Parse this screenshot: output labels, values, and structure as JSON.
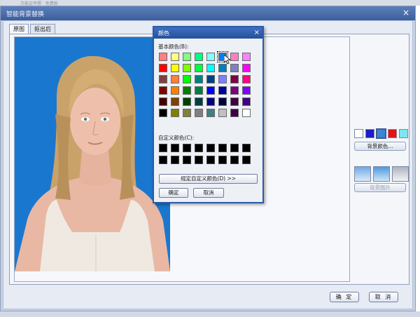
{
  "background_window": {
    "title": "_万能证件照 · 免费版"
  },
  "window": {
    "title": "智能背景替换",
    "close_glyph": "×"
  },
  "tabs": [
    {
      "label": "原图",
      "active": true
    },
    {
      "label": "抠出后",
      "active": false
    }
  ],
  "options": {
    "bg_color_swatches": [
      "#ffffff",
      "#1c1cc8",
      "#3a86d4",
      "#e41414",
      "#7de6f0"
    ],
    "selected_swatch": 2,
    "bg_color_button": "背景颜色...",
    "bg_image_button": "背景图片"
  },
  "footer": {
    "ok": "确 定",
    "cancel": "取 消"
  },
  "color_dialog": {
    "title": "颜色",
    "close_glyph": "×",
    "basic_label": "基本颜色(B):",
    "custom_label": "自定义颜色(C):",
    "define_custom_button": "规定自定义颜色(D) >>",
    "ok": "确定",
    "cancel": "取消",
    "selected_index": 5,
    "basic_colors": [
      "#ff8080",
      "#ffff80",
      "#80ff80",
      "#00ff80",
      "#80ffff",
      "#0080ff",
      "#ff80c0",
      "#ff80ff",
      "#ff0000",
      "#ffff00",
      "#80ff00",
      "#00ff40",
      "#00ffff",
      "#0080c0",
      "#8080c0",
      "#ff00ff",
      "#804040",
      "#ff8040",
      "#00ff00",
      "#008080",
      "#004080",
      "#8080ff",
      "#800040",
      "#ff0080",
      "#800000",
      "#ff8000",
      "#008000",
      "#008040",
      "#0000ff",
      "#0000a0",
      "#800080",
      "#8000ff",
      "#400000",
      "#804000",
      "#004000",
      "#004040",
      "#000080",
      "#000040",
      "#400040",
      "#400080",
      "#000000",
      "#808000",
      "#808040",
      "#808080",
      "#408080",
      "#c0c0c0",
      "#400040",
      "#ffffff"
    ],
    "custom_colors": [
      "#000000",
      "#000000",
      "#000000",
      "#000000",
      "#000000",
      "#000000",
      "#000000",
      "#000000",
      "#000000",
      "#000000",
      "#000000",
      "#000000",
      "#000000",
      "#000000",
      "#000000",
      "#000000"
    ]
  },
  "photo": {
    "background_color": "#1a77cf"
  }
}
